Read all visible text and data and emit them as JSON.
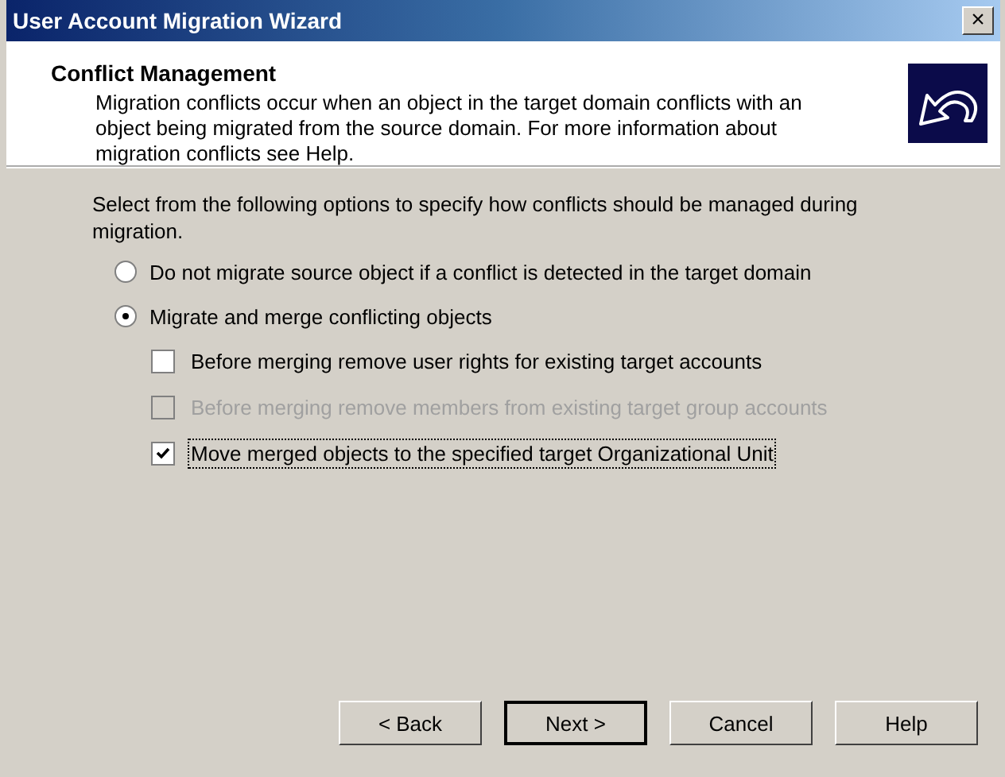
{
  "window": {
    "title": "User Account Migration Wizard",
    "close": "×"
  },
  "header": {
    "title": "Conflict Management",
    "description": "Migration conflicts occur when an object in the target domain conflicts with an object being migrated from the source domain. For more information about migration conflicts see Help."
  },
  "instruction": "Select from the following options to specify how conflicts should be managed during migration.",
  "options": [
    {
      "label": "Do not migrate source object if a conflict is detected in the target domain",
      "selected": false
    },
    {
      "label": "Migrate and merge conflicting objects",
      "selected": true,
      "children": [
        {
          "label": "Before merging remove user rights for existing target accounts",
          "checked": false,
          "disabled": false,
          "focused": false
        },
        {
          "label": "Before merging remove members from existing target group accounts",
          "checked": false,
          "disabled": true,
          "focused": false
        },
        {
          "label": "Move merged objects to the specified target Organizational Unit",
          "checked": true,
          "disabled": false,
          "focused": true
        }
      ]
    }
  ],
  "buttons": [
    {
      "label": "< Back",
      "default": false
    },
    {
      "label": "Next >",
      "default": true
    },
    {
      "label": "Cancel",
      "default": false
    },
    {
      "label": "Help",
      "default": false
    }
  ]
}
